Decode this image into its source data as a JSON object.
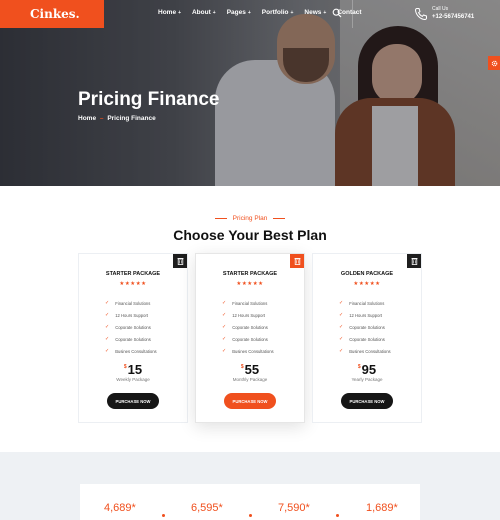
{
  "brand": {
    "logo": "Cinkes.",
    "accent": "#f0501e",
    "dark": "#161616"
  },
  "nav": [
    {
      "label": "Home",
      "has_dropdown": true
    },
    {
      "label": "About",
      "has_dropdown": true
    },
    {
      "label": "Pages",
      "has_dropdown": true
    },
    {
      "label": "Portfolio",
      "has_dropdown": true
    },
    {
      "label": "News",
      "has_dropdown": true
    },
    {
      "label": "Contact",
      "has_dropdown": false
    }
  ],
  "header": {
    "call_label": "Call Us",
    "phone": "+12-567456741"
  },
  "hero": {
    "title": "Pricing Finance",
    "breadcrumb_home": "Home",
    "breadcrumb_sep": "–",
    "breadcrumb_current": "Pricing Finance"
  },
  "pricing": {
    "eyebrow": "Pricing Plan",
    "title": "Choose Your Best Plan",
    "features": [
      "Financial Solutions",
      "12 Hours Support",
      "Coporate Solutions",
      "Coporate Solutions",
      "Busines Consultations"
    ],
    "plans": [
      {
        "name": "STARTER PACKAGE",
        "stars": "★★★★★",
        "currency": "$",
        "price": "15",
        "period": "Weekly Package",
        "button": "PURCHASE NOW",
        "featured": false
      },
      {
        "name": "STARTER PACKAGE",
        "stars": "★★★★★",
        "currency": "$",
        "price": "55",
        "period": "Monthly Package",
        "button": "PURCHASE NOW",
        "featured": true
      },
      {
        "name": "GOLDEN PACKAGE",
        "stars": "★★★★★",
        "currency": "$",
        "price": "95",
        "period": "Yearly Package",
        "button": "PURCHASE NOW",
        "featured": false
      }
    ]
  },
  "stats": [
    "4,689*",
    "6,595*",
    "7,590*",
    "1,689*"
  ]
}
